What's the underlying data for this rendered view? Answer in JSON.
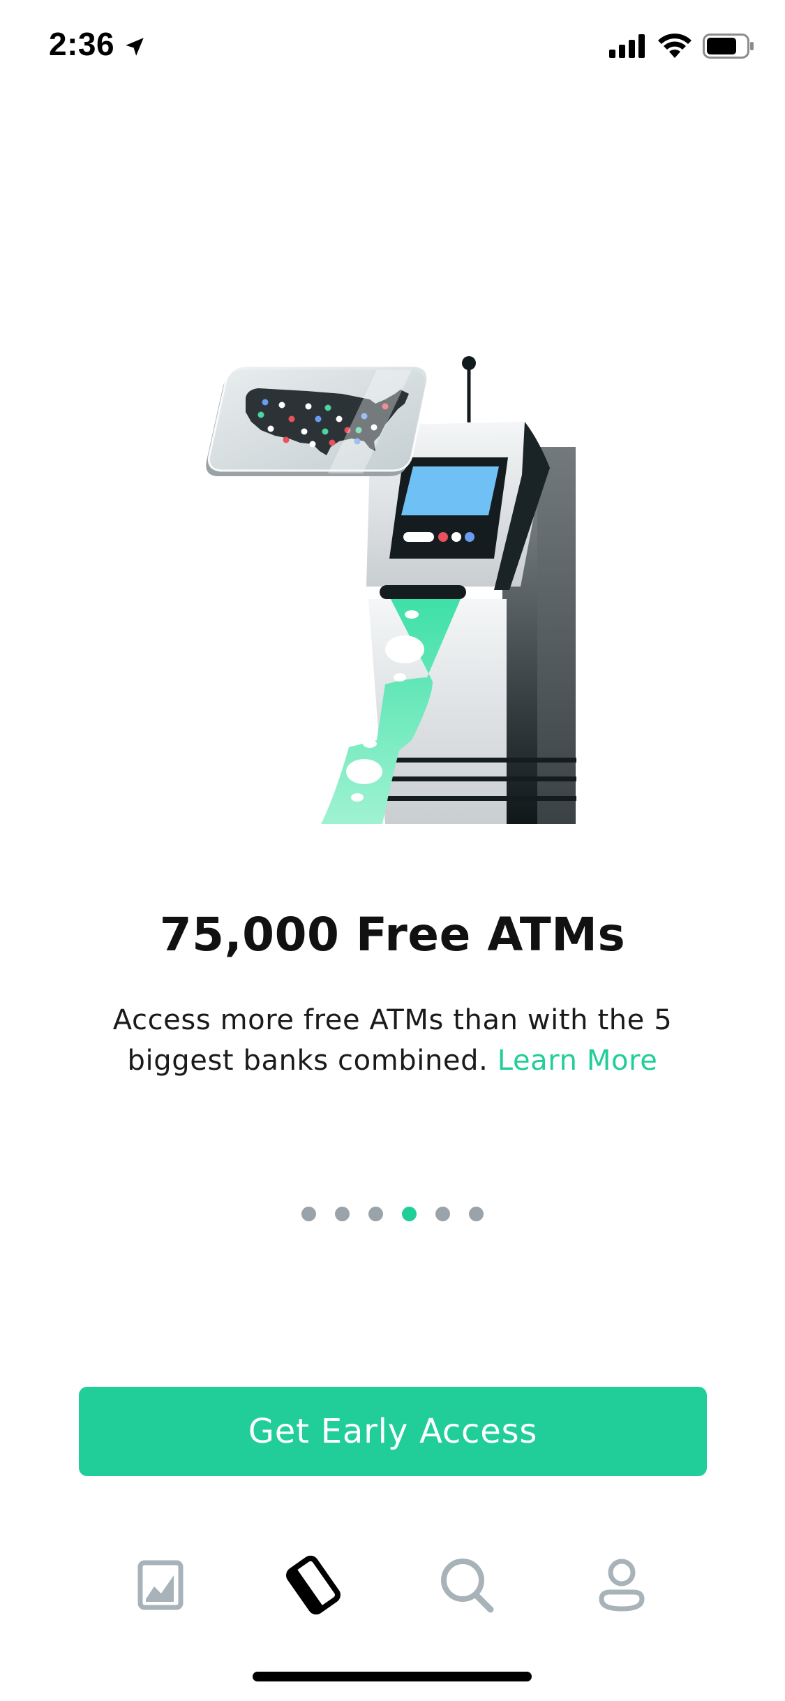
{
  "status_bar": {
    "time": "2:36",
    "icons": [
      "location-arrow-icon",
      "cellular-signal-icon",
      "wifi-icon",
      "battery-icon"
    ]
  },
  "illustration": {
    "subject": "atm-with-us-map-icon",
    "colors": {
      "accent_green": "#21ce99",
      "screen_blue": "#6ec0f5",
      "dark": "#111a1c",
      "map_dot_red": "#e8525c",
      "map_dot_blue": "#6c9cf0",
      "map_dot_green": "#4cd5a0"
    }
  },
  "content": {
    "title": "75,000 Free ATMs",
    "description": "Access more free ATMs than with the 5 biggest banks combined.",
    "learn_more": "Learn More"
  },
  "pagination": {
    "count": 6,
    "active_index": 3
  },
  "cta": {
    "label": "Get Early Access"
  },
  "tabbar": {
    "items": [
      {
        "name": "portfolio-chart-icon",
        "active": false
      },
      {
        "name": "card-icon",
        "active": true
      },
      {
        "name": "search-icon",
        "active": false
      },
      {
        "name": "account-icon",
        "active": false
      }
    ]
  },
  "colors": {
    "accent": "#21ce99",
    "inactive_icon": "#a7b3b8",
    "dot_inactive": "#9aa3a9",
    "text": "#111111"
  }
}
